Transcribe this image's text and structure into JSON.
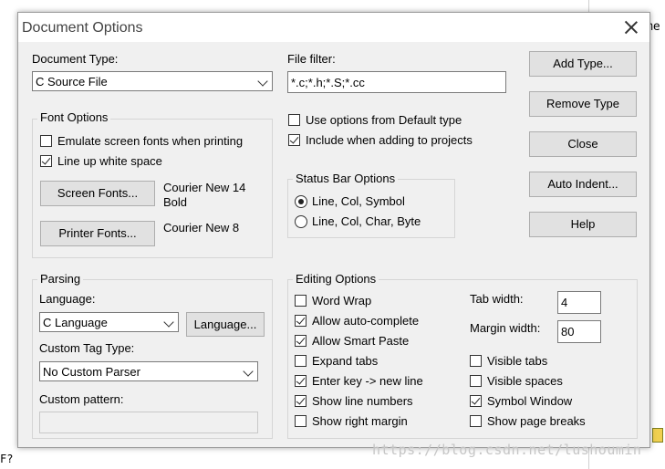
{
  "background": {
    "right_strip_text": "me",
    "bottom_left_text": "F?",
    "watermark": "https://blog.csdn.net/lushoumin"
  },
  "dialog": {
    "title": "Document Options",
    "document_type_label": "Document Type:",
    "document_type_value": "C Source File",
    "file_filter_label": "File filter:",
    "file_filter_value": "*.c;*.h;*.S;*.cc",
    "use_default_label": "Use options from Default type",
    "use_default_checked": false,
    "include_projects_label": "Include when adding to projects",
    "include_projects_checked": true,
    "buttons": {
      "add_type": "Add Type...",
      "remove_type": "Remove Type",
      "close": "Close",
      "auto_indent": "Auto Indent...",
      "help": "Help"
    },
    "font_options": {
      "title": "Font Options",
      "emulate_label": "Emulate screen fonts when printing",
      "emulate_checked": false,
      "lineup_label": "Line up white space",
      "lineup_checked": true,
      "screen_fonts_button": "Screen Fonts...",
      "screen_font_line1": "Courier New 14",
      "screen_font_line2": "Bold",
      "printer_fonts_button": "Printer Fonts...",
      "printer_font": "Courier New 8"
    },
    "status_bar": {
      "title": "Status Bar Options",
      "option1": "Line, Col, Symbol",
      "option2": "Line, Col, Char, Byte",
      "selected": 1
    },
    "parsing": {
      "title": "Parsing",
      "language_label": "Language:",
      "language_value": "C Language",
      "language_button": "Language...",
      "custom_tag_label": "Custom Tag Type:",
      "custom_tag_value": "No Custom Parser",
      "custom_pattern_label": "Custom pattern:",
      "custom_pattern_value": ""
    },
    "editing": {
      "title": "Editing Options",
      "word_wrap": "Word Wrap",
      "allow_autocomplete": "Allow auto-complete",
      "allow_smart_paste": "Allow Smart Paste",
      "expand_tabs": "Expand tabs",
      "enter_key": "Enter key -> new line",
      "show_line_numbers": "Show line numbers",
      "show_right_margin": "Show right margin",
      "tab_width_label": "Tab width:",
      "tab_width_value": "4",
      "margin_width_label": "Margin width:",
      "margin_width_value": "80",
      "visible_tabs": "Visible tabs",
      "visible_spaces": "Visible spaces",
      "symbol_window": "Symbol Window",
      "show_page_breaks": "Show page breaks",
      "checked": {
        "word_wrap": false,
        "allow_autocomplete": true,
        "allow_smart_paste": true,
        "expand_tabs": false,
        "enter_key": true,
        "show_line_numbers": true,
        "show_right_margin": false,
        "visible_tabs": false,
        "visible_spaces": false,
        "symbol_window": true,
        "show_page_breaks": false
      }
    }
  }
}
